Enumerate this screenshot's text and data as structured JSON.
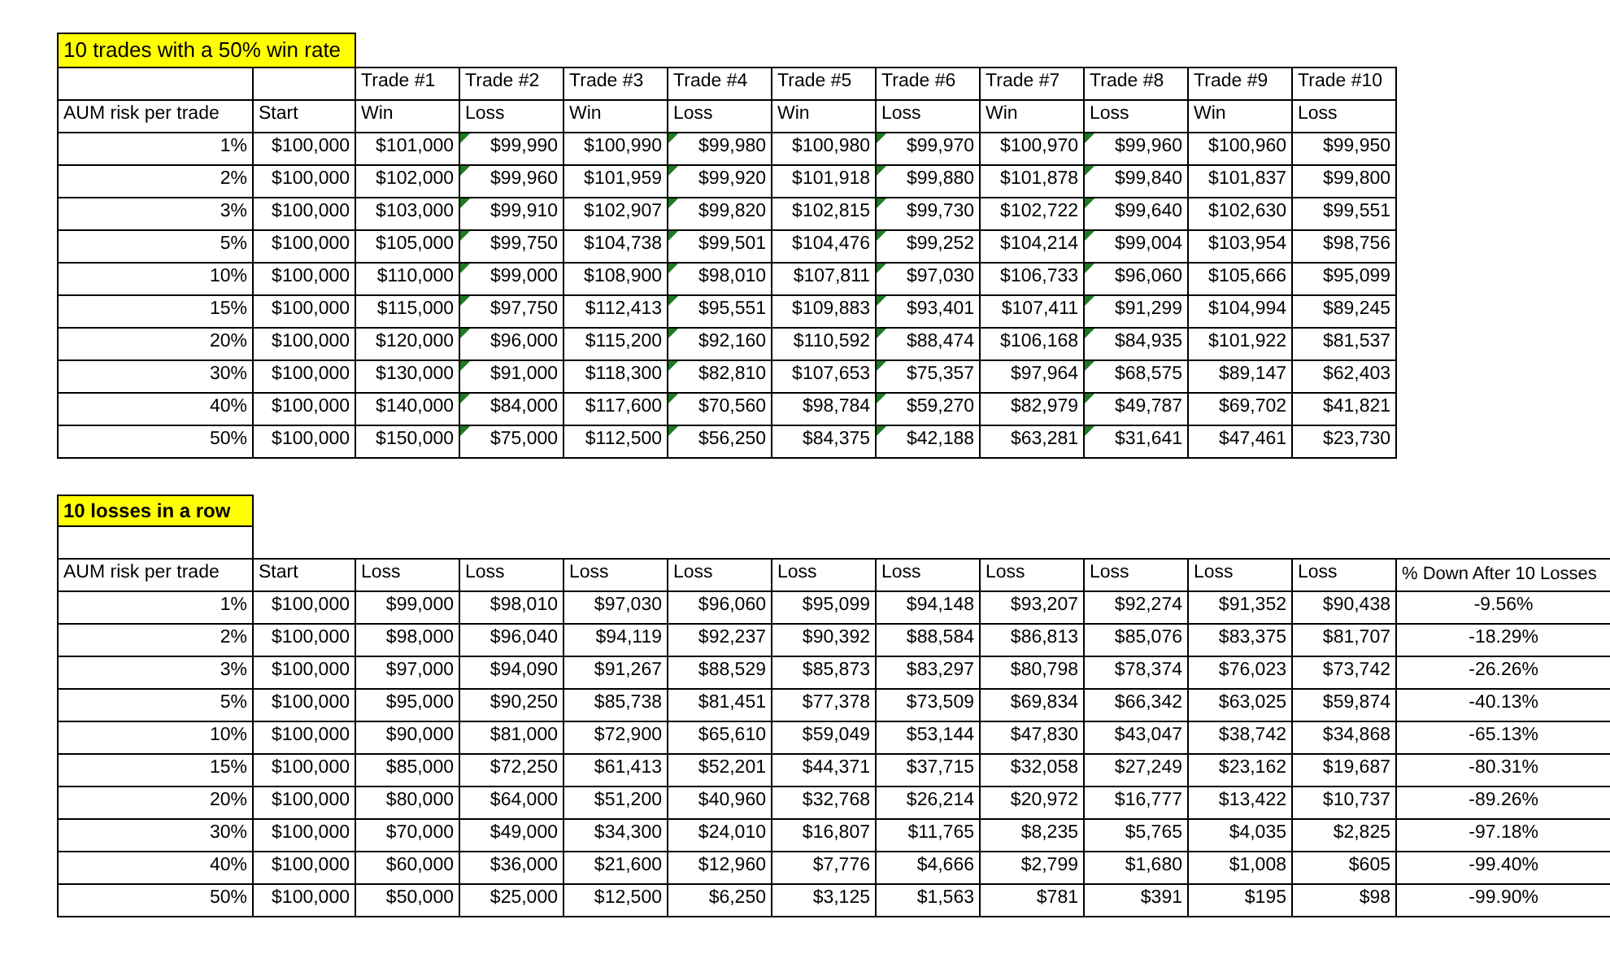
{
  "win_rate_table": {
    "title": "10 trades with a 50% win rate",
    "row_header": "AUM risk per trade",
    "start_header": "Start",
    "columns": [
      {
        "trade": "Trade #1",
        "result": "Win",
        "flagged": false
      },
      {
        "trade": "Trade #2",
        "result": "Loss",
        "flagged": true
      },
      {
        "trade": "Trade #3",
        "result": "Win",
        "flagged": false
      },
      {
        "trade": "Trade #4",
        "result": "Loss",
        "flagged": true
      },
      {
        "trade": "Trade #5",
        "result": "Win",
        "flagged": false
      },
      {
        "trade": "Trade #6",
        "result": "Loss",
        "flagged": true
      },
      {
        "trade": "Trade #7",
        "result": "Win",
        "flagged": false
      },
      {
        "trade": "Trade #8",
        "result": "Loss",
        "flagged": true
      },
      {
        "trade": "Trade #9",
        "result": "Win",
        "flagged": false
      },
      {
        "trade": "Trade #10",
        "result": "Loss",
        "flagged": false
      }
    ],
    "rows": [
      {
        "risk": "1%",
        "start": "$100,000",
        "values": [
          "$101,000",
          "$99,990",
          "$100,990",
          "$99,980",
          "$100,980",
          "$99,970",
          "$100,970",
          "$99,960",
          "$100,960",
          "$99,950"
        ]
      },
      {
        "risk": "2%",
        "start": "$100,000",
        "values": [
          "$102,000",
          "$99,960",
          "$101,959",
          "$99,920",
          "$101,918",
          "$99,880",
          "$101,878",
          "$99,840",
          "$101,837",
          "$99,800"
        ]
      },
      {
        "risk": "3%",
        "start": "$100,000",
        "values": [
          "$103,000",
          "$99,910",
          "$102,907",
          "$99,820",
          "$102,815",
          "$99,730",
          "$102,722",
          "$99,640",
          "$102,630",
          "$99,551"
        ]
      },
      {
        "risk": "5%",
        "start": "$100,000",
        "values": [
          "$105,000",
          "$99,750",
          "$104,738",
          "$99,501",
          "$104,476",
          "$99,252",
          "$104,214",
          "$99,004",
          "$103,954",
          "$98,756"
        ]
      },
      {
        "risk": "10%",
        "start": "$100,000",
        "values": [
          "$110,000",
          "$99,000",
          "$108,900",
          "$98,010",
          "$107,811",
          "$97,030",
          "$106,733",
          "$96,060",
          "$105,666",
          "$95,099"
        ]
      },
      {
        "risk": "15%",
        "start": "$100,000",
        "values": [
          "$115,000",
          "$97,750",
          "$112,413",
          "$95,551",
          "$109,883",
          "$93,401",
          "$107,411",
          "$91,299",
          "$104,994",
          "$89,245"
        ]
      },
      {
        "risk": "20%",
        "start": "$100,000",
        "values": [
          "$120,000",
          "$96,000",
          "$115,200",
          "$92,160",
          "$110,592",
          "$88,474",
          "$106,168",
          "$84,935",
          "$101,922",
          "$81,537"
        ]
      },
      {
        "risk": "30%",
        "start": "$100,000",
        "values": [
          "$130,000",
          "$91,000",
          "$118,300",
          "$82,810",
          "$107,653",
          "$75,357",
          "$97,964",
          "$68,575",
          "$89,147",
          "$62,403"
        ]
      },
      {
        "risk": "40%",
        "start": "$100,000",
        "values": [
          "$140,000",
          "$84,000",
          "$117,600",
          "$70,560",
          "$98,784",
          "$59,270",
          "$82,979",
          "$49,787",
          "$69,702",
          "$41,821"
        ]
      },
      {
        "risk": "50%",
        "start": "$100,000",
        "values": [
          "$150,000",
          "$75,000",
          "$112,500",
          "$56,250",
          "$84,375",
          "$42,188",
          "$63,281",
          "$31,641",
          "$47,461",
          "$23,730"
        ]
      }
    ]
  },
  "losses_table": {
    "title": "10 losses in a row",
    "row_header": "AUM risk per trade",
    "start_header": "Start",
    "columns": [
      "Loss",
      "Loss",
      "Loss",
      "Loss",
      "Loss",
      "Loss",
      "Loss",
      "Loss",
      "Loss",
      "Loss"
    ],
    "summary_header": "% Down After 10 Losses",
    "rows": [
      {
        "risk": "1%",
        "start": "$100,000",
        "values": [
          "$99,000",
          "$98,010",
          "$97,030",
          "$96,060",
          "$95,099",
          "$94,148",
          "$93,207",
          "$92,274",
          "$91,352",
          "$90,438"
        ],
        "down": "-9.56%"
      },
      {
        "risk": "2%",
        "start": "$100,000",
        "values": [
          "$98,000",
          "$96,040",
          "$94,119",
          "$92,237",
          "$90,392",
          "$88,584",
          "$86,813",
          "$85,076",
          "$83,375",
          "$81,707"
        ],
        "down": "-18.29%"
      },
      {
        "risk": "3%",
        "start": "$100,000",
        "values": [
          "$97,000",
          "$94,090",
          "$91,267",
          "$88,529",
          "$85,873",
          "$83,297",
          "$80,798",
          "$78,374",
          "$76,023",
          "$73,742"
        ],
        "down": "-26.26%"
      },
      {
        "risk": "5%",
        "start": "$100,000",
        "values": [
          "$95,000",
          "$90,250",
          "$85,738",
          "$81,451",
          "$77,378",
          "$73,509",
          "$69,834",
          "$66,342",
          "$63,025",
          "$59,874"
        ],
        "down": "-40.13%"
      },
      {
        "risk": "10%",
        "start": "$100,000",
        "values": [
          "$90,000",
          "$81,000",
          "$72,900",
          "$65,610",
          "$59,049",
          "$53,144",
          "$47,830",
          "$43,047",
          "$38,742",
          "$34,868"
        ],
        "down": "-65.13%"
      },
      {
        "risk": "15%",
        "start": "$100,000",
        "values": [
          "$85,000",
          "$72,250",
          "$61,413",
          "$52,201",
          "$44,371",
          "$37,715",
          "$32,058",
          "$27,249",
          "$23,162",
          "$19,687"
        ],
        "down": "-80.31%"
      },
      {
        "risk": "20%",
        "start": "$100,000",
        "values": [
          "$80,000",
          "$64,000",
          "$51,200",
          "$40,960",
          "$32,768",
          "$26,214",
          "$20,972",
          "$16,777",
          "$13,422",
          "$10,737"
        ],
        "down": "-89.26%"
      },
      {
        "risk": "30%",
        "start": "$100,000",
        "values": [
          "$70,000",
          "$49,000",
          "$34,300",
          "$24,010",
          "$16,807",
          "$11,765",
          "$8,235",
          "$5,765",
          "$4,035",
          "$2,825"
        ],
        "down": "-97.18%"
      },
      {
        "risk": "40%",
        "start": "$100,000",
        "values": [
          "$60,000",
          "$36,000",
          "$21,600",
          "$12,960",
          "$7,776",
          "$4,666",
          "$2,799",
          "$1,680",
          "$1,008",
          "$605"
        ],
        "down": "-99.40%"
      },
      {
        "risk": "50%",
        "start": "$100,000",
        "values": [
          "$50,000",
          "$25,000",
          "$12,500",
          "$6,250",
          "$3,125",
          "$1,563",
          "$781",
          "$391",
          "$195",
          "$98"
        ],
        "down": "-99.90%"
      }
    ]
  }
}
